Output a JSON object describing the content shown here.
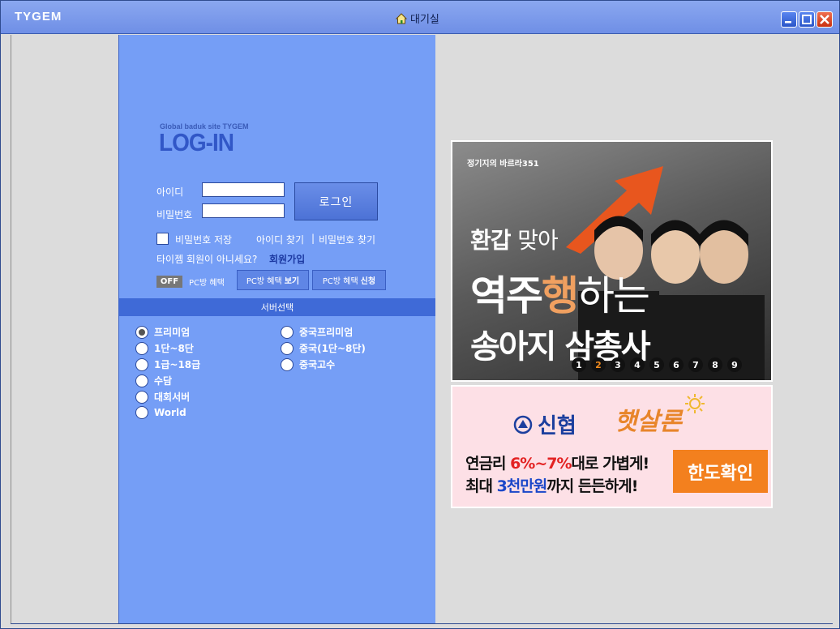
{
  "titlebar": {
    "brand": "TYGEM",
    "title": "대기실"
  },
  "login": {
    "site_subtitle": "Global baduk site TYGEM",
    "site_title": "LOG-IN",
    "id_label": "아이디",
    "password_label": "비밀번호",
    "id_value": "",
    "password_value": "",
    "login_button": "로그인",
    "save_password_label": "비밀번호 저장",
    "find_id": "아이디 찾기",
    "separator": "|",
    "find_password": "비밀번호 찾기",
    "not_member": "타이젬 회원이 아니세요?",
    "join": "회원가입",
    "off_badge": "OFF",
    "pc_benefit": "PC방 혜택",
    "pc_view_prefix": "PC방 혜택",
    "pc_view_bold": "보기",
    "pc_apply_prefix": "PC방 혜택",
    "pc_apply_bold": "신청"
  },
  "server": {
    "header": "서버선택",
    "options_left": [
      "프리미엄",
      "1단~8단",
      "1급~18급",
      "수담",
      "대회서버",
      "World"
    ],
    "options_right": [
      "중국프리미엄",
      "중국(1단~8단)",
      "중국고수"
    ],
    "selected": "프리미엄"
  },
  "ad1": {
    "logo": "정기지의 바르라351",
    "line1_bold": "환갑",
    "line1_rest": "맞아",
    "line2_a": "역주",
    "line2_b": "행",
    "line2_c": "하는",
    "line3": "송아지 삼총사",
    "dots": [
      "1",
      "2",
      "3",
      "4",
      "5",
      "6",
      "7",
      "8",
      "9"
    ],
    "active_dot": "2"
  },
  "ad2": {
    "brand1": "신협",
    "brand2": "햇살론",
    "txt1_a": "연금리 ",
    "txt1_b": "6%~7%",
    "txt1_c": "대로 가볍게!",
    "txt2_a": "최대 ",
    "txt2_b": "3천만원",
    "txt2_c": "까지 든든하게!",
    "cta": "한도확인"
  },
  "colors": {
    "titlebar": "#7a9bec",
    "login_panel": "#759ef6",
    "server_header": "#3f6ad7",
    "cta": "#f3801e"
  }
}
